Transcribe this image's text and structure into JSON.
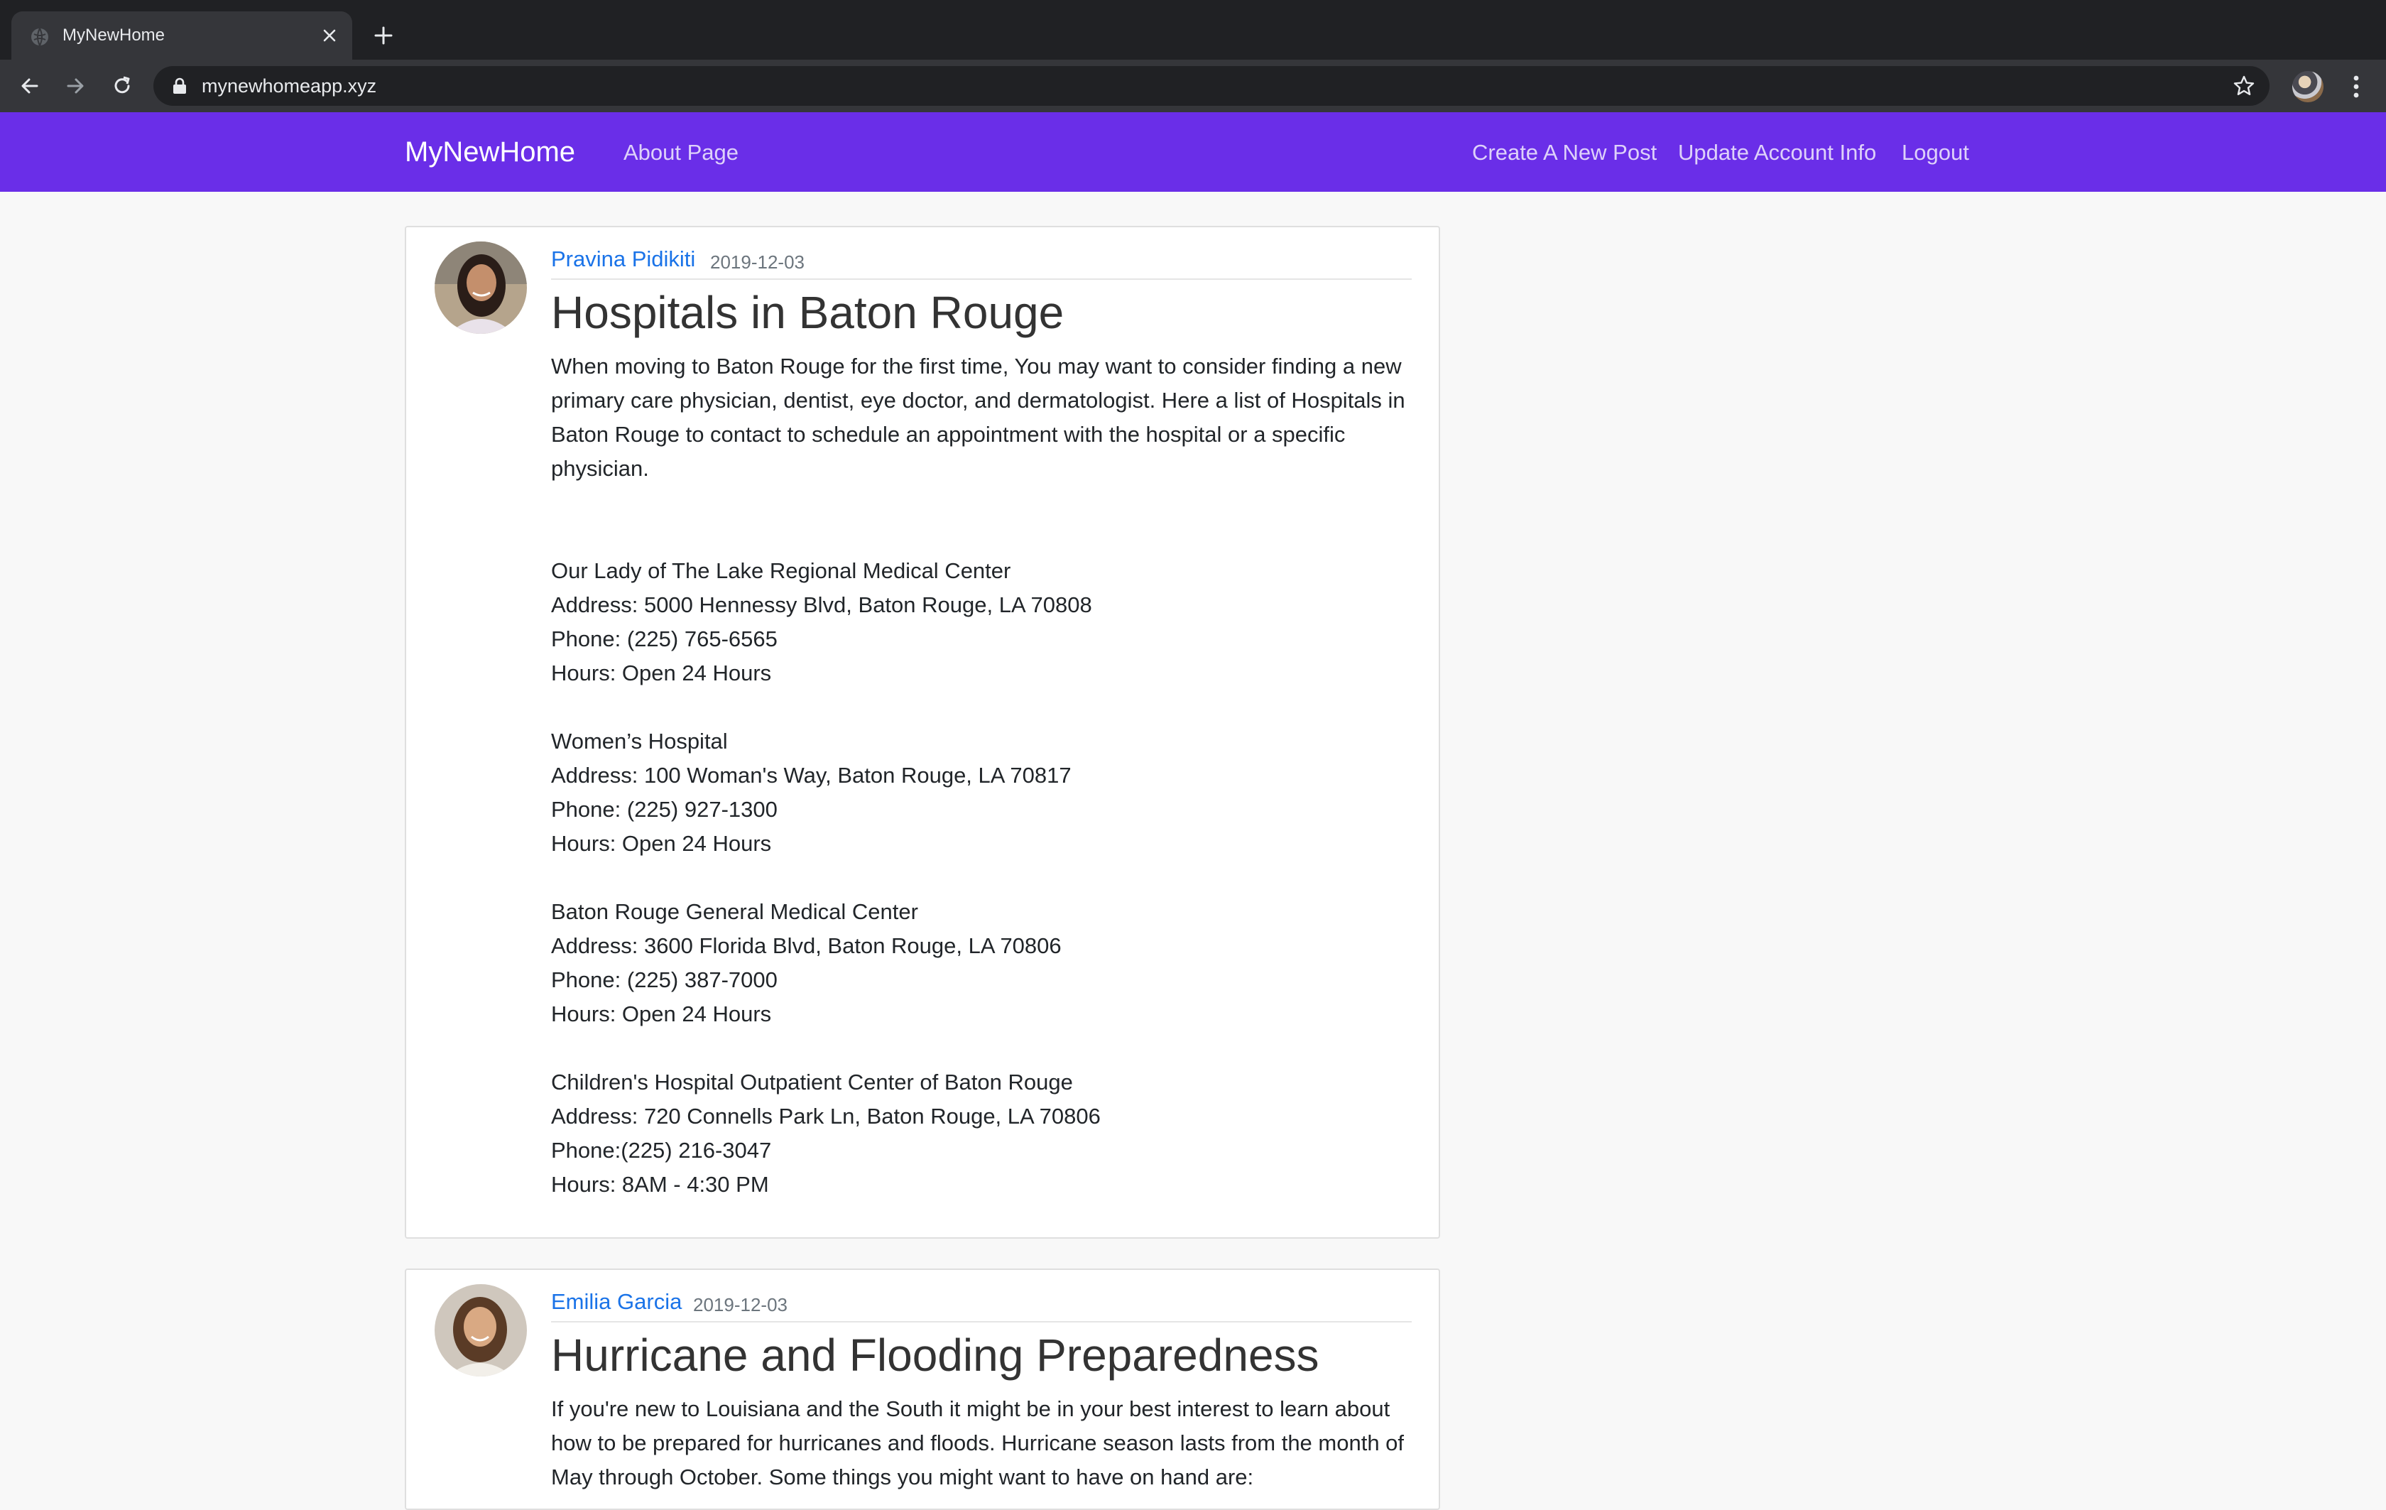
{
  "browser": {
    "tab_title": "MyNewHome",
    "url": "mynewhomeapp.xyz"
  },
  "site": {
    "brand": "MyNewHome",
    "nav_left": [
      "About Page"
    ],
    "nav_right": [
      "Create A New Post",
      "Update Account Info",
      "Logout"
    ],
    "accent_color": "#6a2ee8",
    "link_color": "#1a73e8"
  },
  "posts": [
    {
      "author": "Pravina Pidikiti",
      "date": "2019-12-03",
      "title": "Hospitals in Baton Rouge",
      "intro": "When moving to Baton Rouge for the first time, You may want to consider finding a new primary care physician, dentist, eye doctor, and dermatologist. Here a list of Hospitals in Baton Rouge to contact to schedule an appointment with the hospital or a specific physician.",
      "hospitals": [
        {
          "name": "Our Lady of The Lake Regional Medical Center",
          "address": "Address: 5000 Hennessy Blvd, Baton Rouge, LA 70808",
          "phone": "Phone: (225) 765-6565",
          "hours": "Hours: Open 24 Hours"
        },
        {
          "name": "Women’s Hospital",
          "address": "Address: 100 Woman's Way, Baton Rouge, LA 70817",
          "phone": "Phone: (225) 927-1300",
          "hours": "Hours: Open 24 Hours"
        },
        {
          "name": "Baton Rouge General Medical Center",
          "address": "Address: 3600 Florida Blvd, Baton Rouge, LA 70806",
          "phone": "Phone: (225) 387-7000",
          "hours": "Hours: Open 24 Hours"
        },
        {
          "name": "Children's Hospital Outpatient Center of Baton Rouge",
          "address": "Address: 720 Connells Park Ln, Baton Rouge, LA 70806",
          "phone": "Phone:(225) 216-3047",
          "hours": "Hours: 8AM - 4:30 PM"
        }
      ]
    },
    {
      "author": "Emilia Garcia",
      "date": "2019-12-03",
      "title": "Hurricane and Flooding Preparedness",
      "intro": "If you're new to Louisiana and the South it might be in your best interest to learn about how to be prepared for hurricanes and floods. Hurricane season lasts from the month of May through October. Some things you might want to have on hand are:"
    }
  ]
}
